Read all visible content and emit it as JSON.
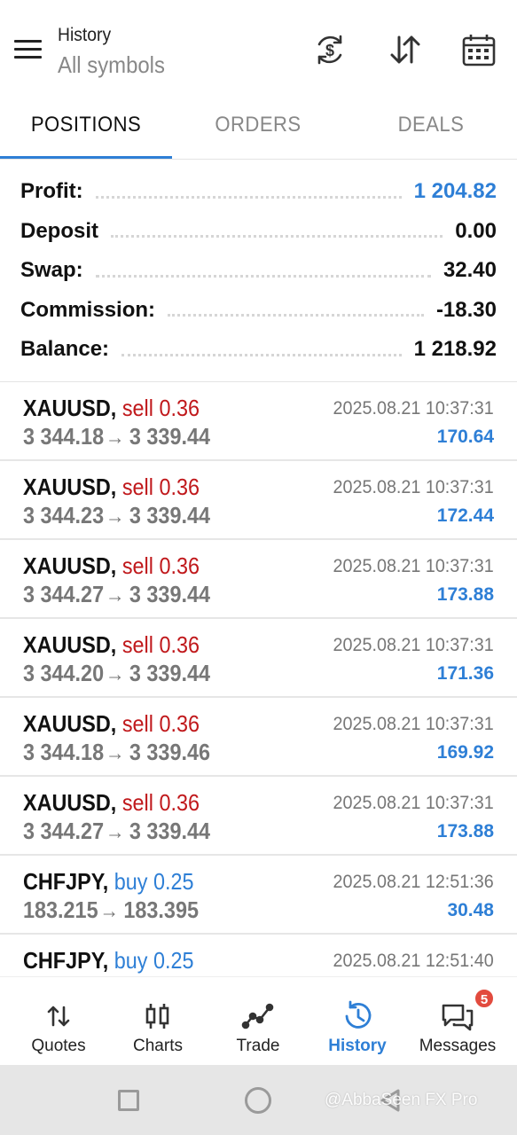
{
  "header": {
    "title": "History",
    "subtitle": "All symbols",
    "icons": [
      "menu-icon",
      "currency-exchange-icon",
      "sort-icon",
      "calendar-icon"
    ]
  },
  "tabs": [
    {
      "label": "POSITIONS",
      "active": true
    },
    {
      "label": "ORDERS",
      "active": false
    },
    {
      "label": "DEALS",
      "active": false
    }
  ],
  "summary": [
    {
      "label": "Profit:",
      "value": "1 204.82",
      "highlight": true
    },
    {
      "label": "Deposit",
      "value": "0.00",
      "highlight": false
    },
    {
      "label": "Swap:",
      "value": "32.40",
      "highlight": false
    },
    {
      "label": "Commission:",
      "value": "-18.30",
      "highlight": false
    },
    {
      "label": "Balance:",
      "value": "1 218.92",
      "highlight": false
    }
  ],
  "trades": [
    {
      "symbol": "XAUUSD,",
      "side": "sell 0.36",
      "side_type": "sell",
      "open": "3 344.18",
      "arrow": "→",
      "close": "3 339.44",
      "time": "2025.08.21 10:37:31",
      "profit": "170.64"
    },
    {
      "symbol": "XAUUSD,",
      "side": "sell 0.36",
      "side_type": "sell",
      "open": "3 344.23",
      "arrow": "→",
      "close": "3 339.44",
      "time": "2025.08.21 10:37:31",
      "profit": "172.44"
    },
    {
      "symbol": "XAUUSD,",
      "side": "sell 0.36",
      "side_type": "sell",
      "open": "3 344.27",
      "arrow": "→",
      "close": "3 339.44",
      "time": "2025.08.21 10:37:31",
      "profit": "173.88"
    },
    {
      "symbol": "XAUUSD,",
      "side": "sell 0.36",
      "side_type": "sell",
      "open": "3 344.20",
      "arrow": "→",
      "close": "3 339.44",
      "time": "2025.08.21 10:37:31",
      "profit": "171.36"
    },
    {
      "symbol": "XAUUSD,",
      "side": "sell 0.36",
      "side_type": "sell",
      "open": "3 344.18",
      "arrow": "→",
      "close": "3 339.46",
      "time": "2025.08.21 10:37:31",
      "profit": "169.92"
    },
    {
      "symbol": "XAUUSD,",
      "side": "sell 0.36",
      "side_type": "sell",
      "open": "3 344.27",
      "arrow": "→",
      "close": "3 339.44",
      "time": "2025.08.21 10:37:31",
      "profit": "173.88"
    },
    {
      "symbol": "CHFJPY,",
      "side": "buy 0.25",
      "side_type": "buy",
      "open": "183.215",
      "arrow": "→",
      "close": "183.395",
      "time": "2025.08.21 12:51:36",
      "profit": "30.48"
    },
    {
      "symbol": "CHFJPY,",
      "side": "buy 0.25",
      "side_type": "buy",
      "open": "",
      "arrow": "",
      "close": "",
      "time": "2025.08.21 12:51:40",
      "profit": ""
    }
  ],
  "nav": [
    {
      "label": "Quotes",
      "icon": "quotes-icon",
      "active": false
    },
    {
      "label": "Charts",
      "icon": "candlestick-chart-icon",
      "active": false
    },
    {
      "label": "Trade",
      "icon": "trade-line-icon",
      "active": false
    },
    {
      "label": "History",
      "icon": "history-icon",
      "active": true
    },
    {
      "label": "Messages",
      "icon": "messages-icon",
      "active": false,
      "badge": "5"
    }
  ],
  "system_bar": {
    "watermark": "@AbbaSeen FX Pro"
  },
  "colors": {
    "accent": "#2e7fd6",
    "sell": "#c0181b",
    "badge": "#e24b3e"
  }
}
